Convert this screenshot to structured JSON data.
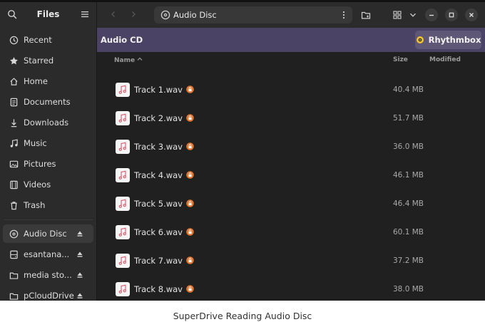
{
  "sidebar": {
    "title": "Files",
    "places": [
      {
        "label": "Recent",
        "icon": "clock-icon"
      },
      {
        "label": "Starred",
        "icon": "star-icon"
      },
      {
        "label": "Home",
        "icon": "home-icon"
      },
      {
        "label": "Documents",
        "icon": "document-icon"
      },
      {
        "label": "Downloads",
        "icon": "download-icon"
      },
      {
        "label": "Music",
        "icon": "music-note-icon"
      },
      {
        "label": "Pictures",
        "icon": "picture-icon"
      },
      {
        "label": "Videos",
        "icon": "film-icon"
      },
      {
        "label": "Trash",
        "icon": "trash-icon"
      }
    ],
    "devices": [
      {
        "label": "Audio Disc",
        "icon": "disc-icon",
        "active": true
      },
      {
        "label": "esantana...",
        "icon": "drive-icon"
      },
      {
        "label": "media sto...",
        "icon": "folder-icon"
      },
      {
        "label": "pCloudDrive",
        "icon": "folder-icon"
      }
    ]
  },
  "header": {
    "path": "Audio Disc"
  },
  "banner": {
    "label": "Audio CD",
    "button_label": "Rhythmbox"
  },
  "columns": {
    "name": "Name",
    "size": "Size",
    "modified": "Modified"
  },
  "files": [
    {
      "name": "Track 1.wav",
      "size": "40.4 MB"
    },
    {
      "name": "Track 2.wav",
      "size": "51.7 MB"
    },
    {
      "name": "Track 3.wav",
      "size": "36.0 MB"
    },
    {
      "name": "Track 4.wav",
      "size": "46.1 MB"
    },
    {
      "name": "Track 5.wav",
      "size": "46.4 MB"
    },
    {
      "name": "Track 6.wav",
      "size": "60.1 MB"
    },
    {
      "name": "Track 7.wav",
      "size": "37.2 MB"
    },
    {
      "name": "Track 8.wav",
      "size": "38.0 MB"
    }
  ],
  "caption": "SuperDrive Reading Audio Disc",
  "colors": {
    "banner": "#4a4366",
    "accent_lock": "#e0762e",
    "music_icon": "#e0566b"
  }
}
